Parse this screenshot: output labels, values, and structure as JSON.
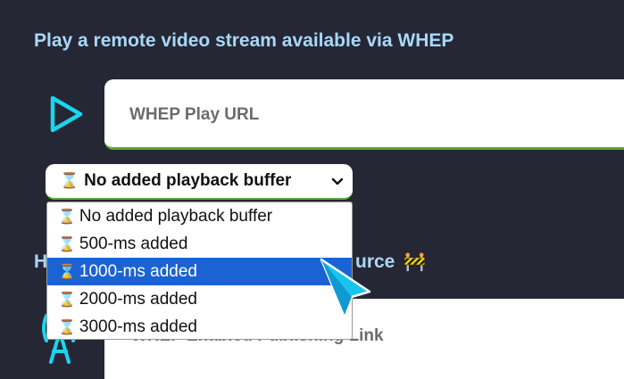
{
  "heading": "Play a remote video stream available via WHEP",
  "play_url": {
    "placeholder": "WHEP Play URL",
    "value": ""
  },
  "buffer_select": {
    "selected_label": "No added playback buffer",
    "icon": "hourglass-icon",
    "options": [
      "No added playback buffer",
      "500-ms added",
      "1000-ms added",
      "2000-ms added",
      "3000-ms added"
    ],
    "highlighted_index": 2
  },
  "section2": {
    "heading_prefix": "H",
    "heading_suffix": "urce",
    "icon": "construction-barrier-icon"
  },
  "publish_box": {
    "label": "WHEP Enabled Publishing Link"
  },
  "colors": {
    "background": "#262734",
    "heading": "#a8d8f8",
    "icon_cyan": "#19d6f0",
    "accent_green": "#5aa832",
    "selection_blue": "#1b63d3"
  }
}
